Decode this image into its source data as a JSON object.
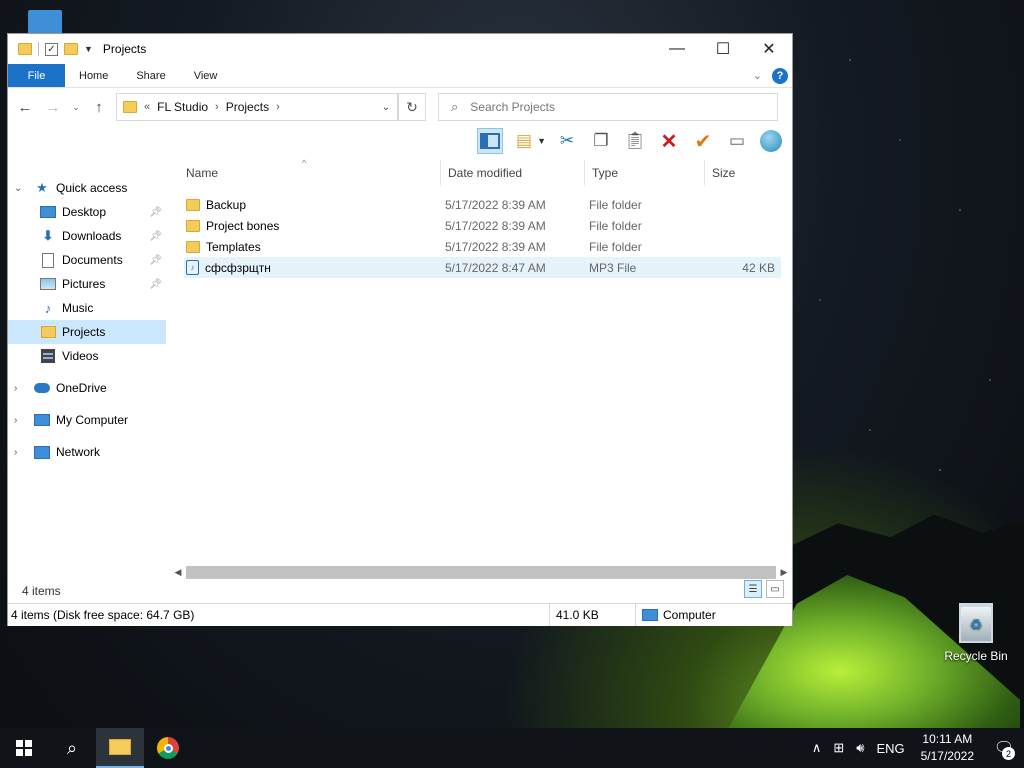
{
  "window": {
    "title": "Projects",
    "controls": {
      "minimize": "—",
      "maximize": "☐",
      "close": "✕"
    }
  },
  "ribbon": {
    "tabs": [
      "File",
      "Home",
      "Share",
      "View"
    ],
    "help": "?"
  },
  "address": {
    "overflow": "«",
    "crumbs": [
      "FL Studio",
      "Projects"
    ],
    "search_placeholder": "Search Projects"
  },
  "nav": {
    "quick_access": "Quick access",
    "items": [
      {
        "label": "Desktop",
        "pinned": true
      },
      {
        "label": "Downloads",
        "pinned": true
      },
      {
        "label": "Documents",
        "pinned": true
      },
      {
        "label": "Pictures",
        "pinned": true
      },
      {
        "label": "Music",
        "pinned": false
      },
      {
        "label": "Projects",
        "pinned": false,
        "selected": true
      },
      {
        "label": "Videos",
        "pinned": false
      }
    ],
    "onedrive": "OneDrive",
    "my_computer": "My Computer",
    "network": "Network"
  },
  "columns": {
    "name": "Name",
    "date": "Date modified",
    "type": "Type",
    "size": "Size"
  },
  "files": [
    {
      "name": "Backup",
      "date": "5/17/2022 8:39 AM",
      "type": "File folder",
      "size": ""
    },
    {
      "name": "Project bones",
      "date": "5/17/2022 8:39 AM",
      "type": "File folder",
      "size": ""
    },
    {
      "name": "Templates",
      "date": "5/17/2022 8:39 AM",
      "type": "File folder",
      "size": ""
    },
    {
      "name": "сфсфзрщтн",
      "date": "5/17/2022 8:47 AM",
      "type": "MP3 File",
      "size": "42 KB"
    }
  ],
  "items_count": "4 items",
  "status": {
    "left": "4 items (Disk free space: 64.7 GB)",
    "size": "41.0 KB",
    "location": "Computer"
  },
  "desktop": {
    "recycle_bin": "Recycle Bin"
  },
  "taskbar": {
    "language": "ENG",
    "time": "10:11 AM",
    "date": "5/17/2022",
    "notifications": "2"
  }
}
